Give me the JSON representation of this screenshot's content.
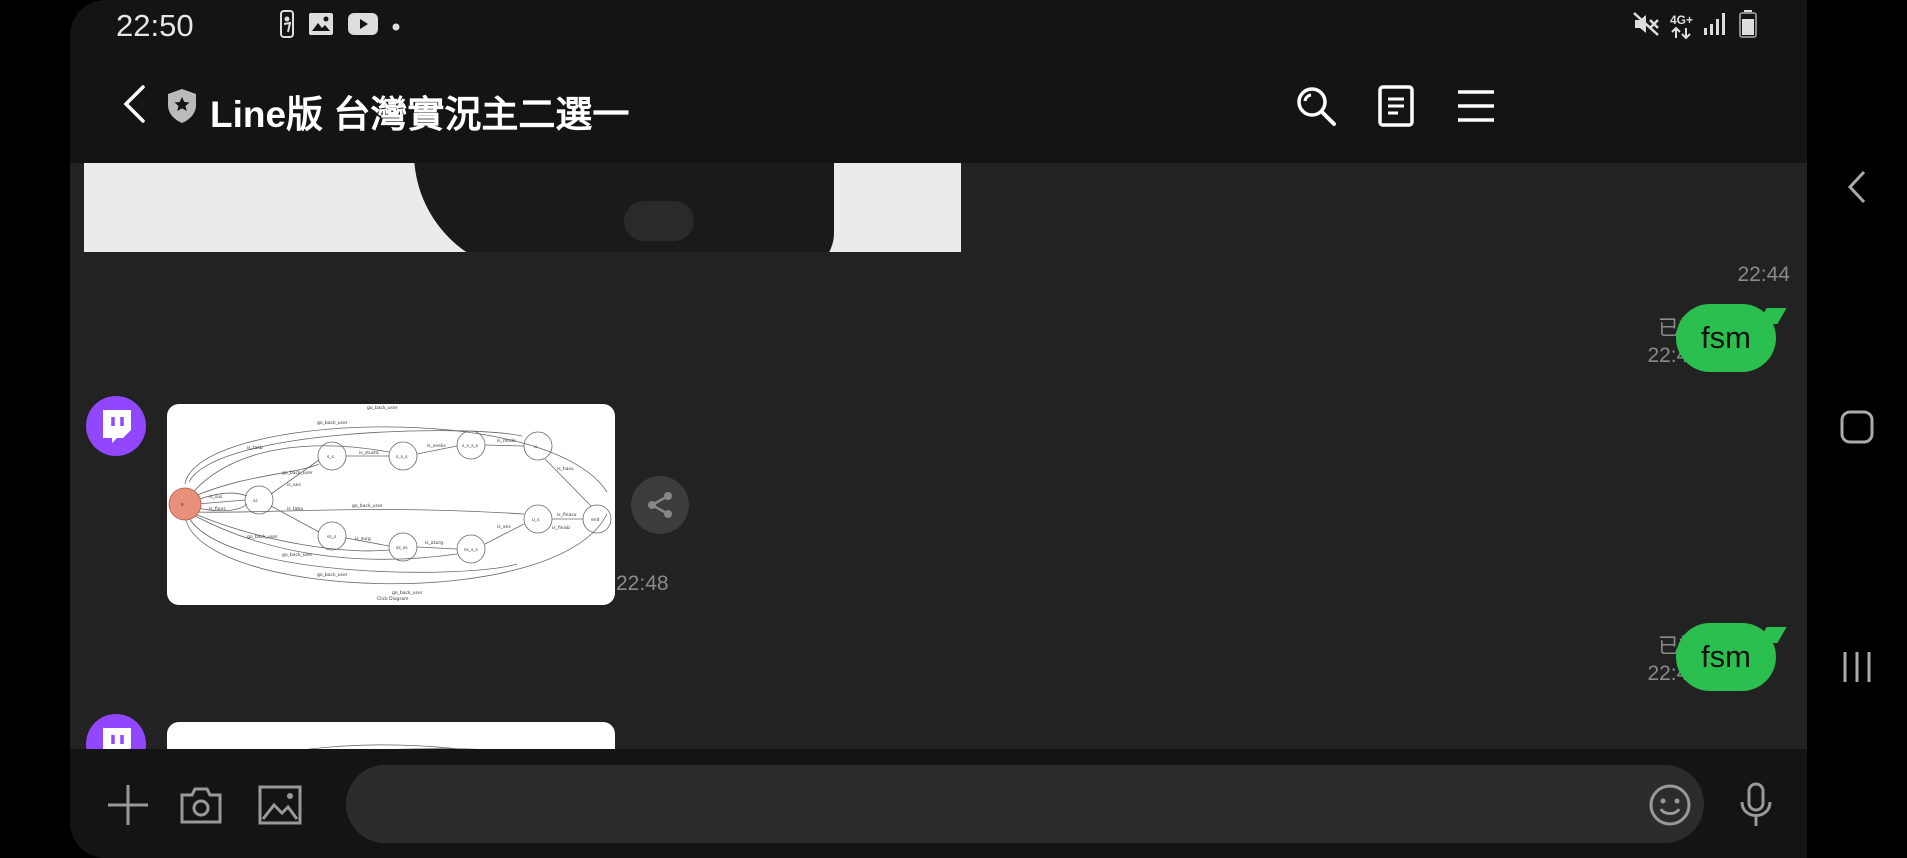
{
  "status_bar": {
    "time": "22:50",
    "icons": [
      "nba-icon",
      "gallery-icon",
      "youtube-icon",
      "dot-icon"
    ],
    "network": "4G+",
    "right_icons": [
      "mute-icon",
      "network-4g-icon",
      "signal-icon",
      "battery-icon"
    ]
  },
  "header": {
    "title": "Line版 台灣實況主二選一",
    "buttons": [
      "search-icon",
      "notes-icon",
      "menu-icon"
    ]
  },
  "messages": [
    {
      "type": "image-partial",
      "sender": "other",
      "time": "22:44"
    },
    {
      "type": "text",
      "sender": "me",
      "text": "fsm",
      "read_label": "已讀",
      "time": "22:48"
    },
    {
      "type": "image",
      "sender": "other",
      "time": "22:48",
      "shareable": true
    },
    {
      "type": "text",
      "sender": "me",
      "text": "fsm",
      "read_label": "已讀",
      "time": "22:49"
    },
    {
      "type": "image-partial",
      "sender": "other"
    }
  ],
  "fsm_diagram": {
    "initial_state": "s",
    "states": [
      "s",
      "ss",
      "s_s",
      "s_s_s",
      "s_s_s_s",
      "ss_s",
      "ss_ss",
      "ss_s_s",
      "end",
      "u",
      "u_s"
    ],
    "edge_labels": [
      "go_back_user",
      "go_back_user",
      "is_tasb",
      "go_back_user",
      "is_ans",
      "is_stusta",
      "is_seeks",
      "is_mode",
      "is_hasu",
      "go_back_user",
      "is_sus",
      "is_fiuns",
      "is_taba",
      "is_zurg",
      "is_zzurg",
      "is_ans",
      "go_back_user",
      "is_finasu",
      "is_finisb",
      "go_back_user",
      "go_back_user",
      "go_back_user",
      "Click Diagram"
    ]
  },
  "input": {
    "placeholder": "",
    "value": ""
  },
  "colors": {
    "bubble": "#2bbf4f",
    "avatar": "#9146ff",
    "background": "#222222",
    "header": "#141414"
  }
}
